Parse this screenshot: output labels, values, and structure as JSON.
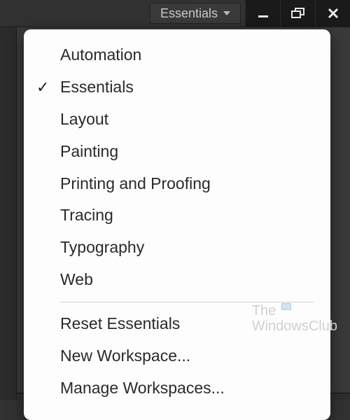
{
  "titlebar": {
    "workspace_button_label": "Essentials"
  },
  "menu": {
    "selected_index": 1,
    "group1": [
      {
        "label": "Automation"
      },
      {
        "label": "Essentials"
      },
      {
        "label": "Layout"
      },
      {
        "label": "Painting"
      },
      {
        "label": "Printing and Proofing"
      },
      {
        "label": "Tracing"
      },
      {
        "label": "Typography"
      },
      {
        "label": "Web"
      }
    ],
    "group2": [
      {
        "label": "Reset Essentials"
      },
      {
        "label": "New Workspace..."
      },
      {
        "label": "Manage Workspaces..."
      }
    ]
  },
  "watermark": {
    "line1": "The",
    "line2": "WindowsClub"
  }
}
